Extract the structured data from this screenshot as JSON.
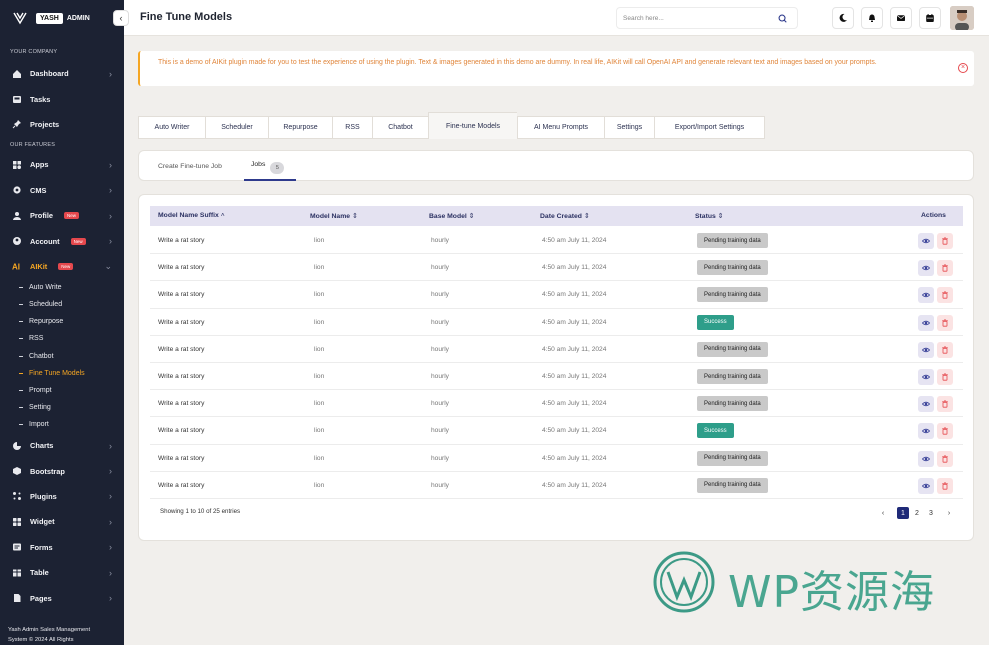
{
  "brand": {
    "pill": "YASH",
    "name": "ADMIN"
  },
  "sidebar": {
    "section_company": "YOUR COMPANY",
    "section_features": "OUR FEATURES",
    "company_items": [
      {
        "label": "Dashboard",
        "icon": "home-icon",
        "chevron": true
      },
      {
        "label": "Tasks",
        "icon": "inbox-icon",
        "chevron": false
      },
      {
        "label": "Projects",
        "icon": "pin-icon",
        "chevron": false
      }
    ],
    "feature_items": [
      {
        "label": "Apps",
        "icon": "apps-icon",
        "chevron": true
      },
      {
        "label": "CMS",
        "icon": "gear-icon",
        "chevron": true
      },
      {
        "label": "Profile",
        "icon": "user-icon",
        "chevron": true,
        "badge": "New"
      },
      {
        "label": "Account",
        "icon": "account-icon",
        "chevron": true,
        "badge": "New"
      },
      {
        "label": "AIKit",
        "icon": "ai-icon",
        "chevron": true,
        "badge": "New",
        "active": true
      }
    ],
    "aikit_sub": [
      "Auto Write",
      "Scheduled",
      "Repurpose",
      "RSS",
      "Chatbot",
      "Fine Tune Models",
      "Prompt",
      "Setting",
      "Import"
    ],
    "aikit_active_sub": "Fine Tune Models",
    "more_items": [
      {
        "label": "Charts",
        "icon": "pie-chart-icon"
      },
      {
        "label": "Bootstrap",
        "icon": "bootstrap-icon"
      },
      {
        "label": "Plugins",
        "icon": "plug-icon"
      },
      {
        "label": "Widget",
        "icon": "widget-icon"
      },
      {
        "label": "Forms",
        "icon": "form-icon"
      },
      {
        "label": "Table",
        "icon": "table-icon"
      },
      {
        "label": "Pages",
        "icon": "pages-icon"
      }
    ],
    "footer_line1": "Yash Admin Sales Management",
    "footer_line2": "System © 2024 All Rights"
  },
  "header": {
    "title": "Fine Tune Models",
    "search_placeholder": "Search here...",
    "icons": [
      "moon-icon",
      "bell-icon",
      "mail-icon",
      "calendar-icon"
    ]
  },
  "alert": {
    "text": "This is a demo of AIKit plugin made for you to test the experience of using the plugin. Text & images generated in this demo are dummy. In real life, AIKit will call OpenAI API and generate relevant text and images based on your prompts."
  },
  "tabs": [
    "Auto Writer",
    "Scheduler",
    "Repurpose",
    "RSS",
    "Chatbot",
    "Fine-tune Models",
    "AI Menu Prompts",
    "Settings",
    "Export/Import Settings"
  ],
  "active_tab": "Fine-tune Models",
  "subtabs": {
    "create": "Create Fine-tune Job",
    "jobs": "Jobs",
    "jobs_count": "5"
  },
  "table": {
    "headers": {
      "suffix": "Model Name Suffix",
      "name": "Model Name",
      "base": "Base Model",
      "date": "Date Created",
      "status": "Status",
      "actions": "Actions"
    },
    "rows": [
      {
        "suffix": "Write a rat story",
        "name": "lion",
        "base": "hourly",
        "date": "4:50 am July 11, 2024",
        "status": "Pending training data"
      },
      {
        "suffix": "Write a rat story",
        "name": "lion",
        "base": "hourly",
        "date": "4:50 am July 11, 2024",
        "status": "Pending training data"
      },
      {
        "suffix": "Write a rat story",
        "name": "lion",
        "base": "hourly",
        "date": "4:50 am July 11, 2024",
        "status": "Pending training data"
      },
      {
        "suffix": "Write a rat story",
        "name": "lion",
        "base": "hourly",
        "date": "4:50 am July 11, 2024",
        "status": "Success"
      },
      {
        "suffix": "Write a rat story",
        "name": "lion",
        "base": "hourly",
        "date": "4:50 am July 11, 2024",
        "status": "Pending training data"
      },
      {
        "suffix": "Write a rat story",
        "name": "lion",
        "base": "hourly",
        "date": "4:50 am July 11, 2024",
        "status": "Pending training data"
      },
      {
        "suffix": "Write a rat story",
        "name": "lion",
        "base": "hourly",
        "date": "4:50 am July 11, 2024",
        "status": "Pending training data"
      },
      {
        "suffix": "Write a rat story",
        "name": "lion",
        "base": "hourly",
        "date": "4:50 am July 11, 2024",
        "status": "Success"
      },
      {
        "suffix": "Write a rat story",
        "name": "lion",
        "base": "hourly",
        "date": "4:50 am July 11, 2024",
        "status": "Pending training data"
      },
      {
        "suffix": "Write a rat story",
        "name": "lion",
        "base": "hourly",
        "date": "4:50 am July 11, 2024",
        "status": "Pending training data"
      }
    ],
    "showing": "Showing 1 to 10 of 25 entries",
    "pages": [
      "1",
      "2",
      "3"
    ],
    "current_page": "1",
    "prev": "‹",
    "next": "›"
  },
  "watermark": {
    "text": "WP资源海"
  },
  "colors": {
    "sidebar_bg": "#1c2233",
    "accent": "#f5a623",
    "primary": "#1f2a78",
    "success": "#2e9e8a",
    "danger": "#e5484d"
  }
}
